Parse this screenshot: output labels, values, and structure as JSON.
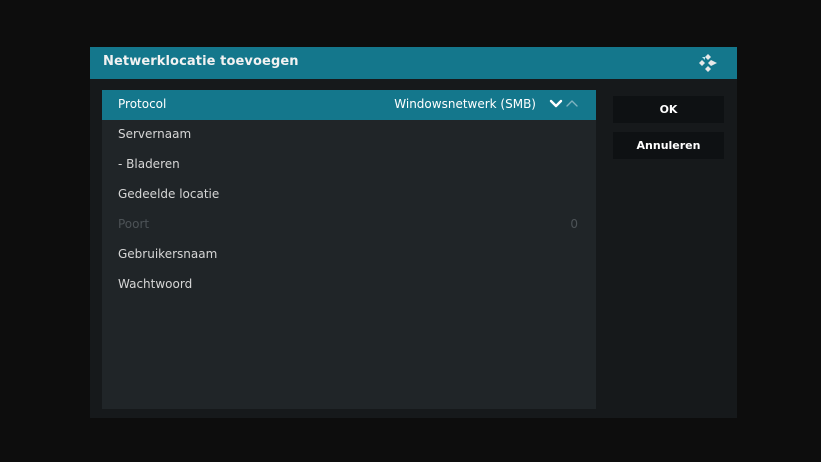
{
  "dialog": {
    "title": "Netwerklocatie toevoegen",
    "logo_icon": "kodi-logo-icon"
  },
  "settings": [
    {
      "label": "Protocol",
      "value": "Windowsnetwerk (SMB)",
      "state": "focused"
    },
    {
      "label": "Servernaam",
      "value": "",
      "state": "normal"
    },
    {
      "label": "- Bladeren",
      "value": "",
      "state": "normal"
    },
    {
      "label": "Gedeelde locatie",
      "value": "",
      "state": "normal"
    },
    {
      "label": "Poort",
      "value": "0",
      "state": "disabled"
    },
    {
      "label": "Gebruikersnaam",
      "value": "",
      "state": "normal"
    },
    {
      "label": "Wachtwoord",
      "value": "",
      "state": "normal"
    }
  ],
  "spinner": {
    "down_icon": "chevron-down-icon",
    "up_icon": "chevron-up-icon"
  },
  "buttons": {
    "ok_label": "OK",
    "cancel_label": "Annuleren"
  },
  "colors": {
    "accent": "#14778c",
    "dialog_bg": "#16191b",
    "list_bg": "#202528",
    "button_bg": "#0e1113",
    "text": "#d6d6d6",
    "disabled_text": "#4d5357"
  }
}
